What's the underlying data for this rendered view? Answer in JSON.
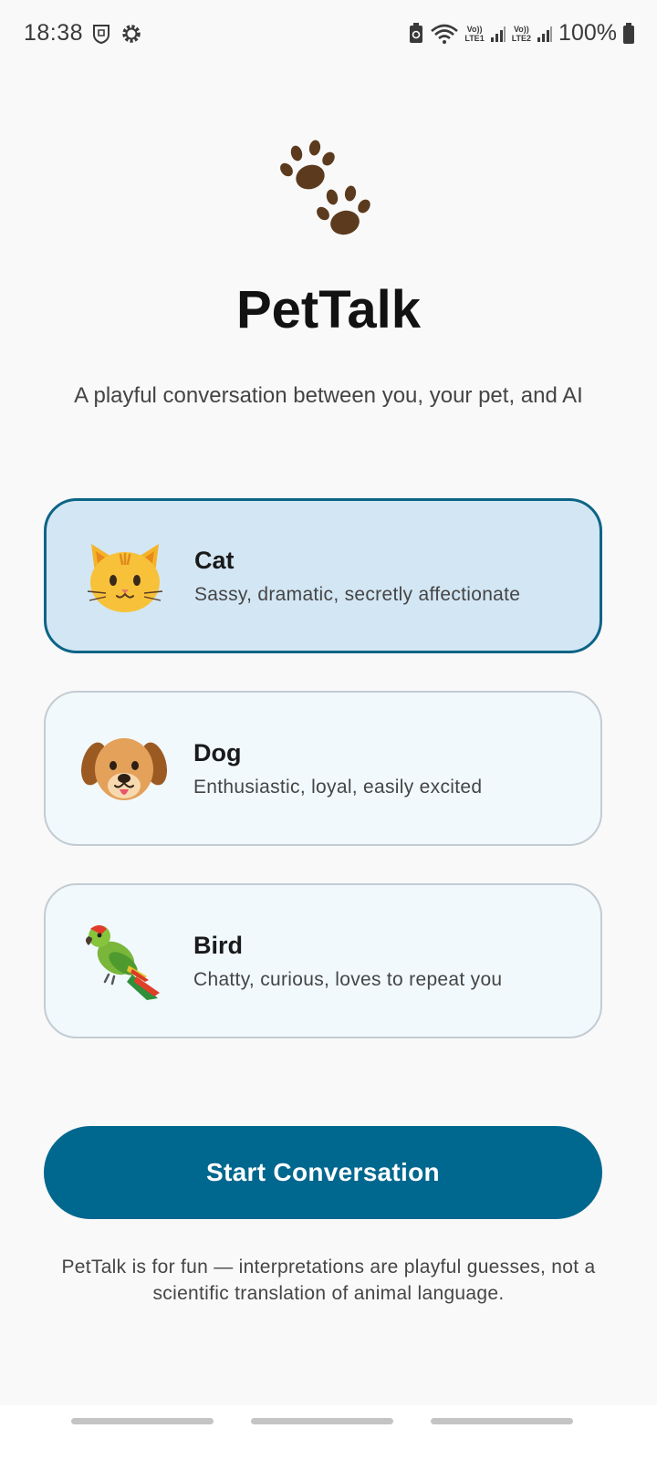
{
  "status_bar": {
    "time": "18:38",
    "lte1": [
      "Vo))",
      "LTE1"
    ],
    "lte2": [
      "Vo))",
      "LTE2"
    ],
    "battery": "100%"
  },
  "app": {
    "title": "PetTalk",
    "subtitle": "A playful conversation between you, your pet, and AI",
    "logo_icon": "paw-prints-icon"
  },
  "pets": [
    {
      "name": "Cat",
      "description": "Sassy, dramatic, secretly affectionate",
      "icon": "cat-face-icon",
      "selected": true
    },
    {
      "name": "Dog",
      "description": "Enthusiastic, loyal, easily excited",
      "icon": "dog-face-icon",
      "selected": false
    },
    {
      "name": "Bird",
      "description": "Chatty, curious, loves to repeat you",
      "icon": "parrot-icon",
      "selected": false
    }
  ],
  "start_button_label": "Start Conversation",
  "disclaimer": "PetTalk is for fun — interpretations are playful guesses, not a scientific translation of animal language.",
  "colors": {
    "primary": "#00678e",
    "selected_card_bg": "#d3e6f4",
    "selected_card_border": "#0c6486",
    "card_bg": "#f1f9fd",
    "card_border": "#c3ccd2",
    "page_bg": "#f9f9f9"
  }
}
